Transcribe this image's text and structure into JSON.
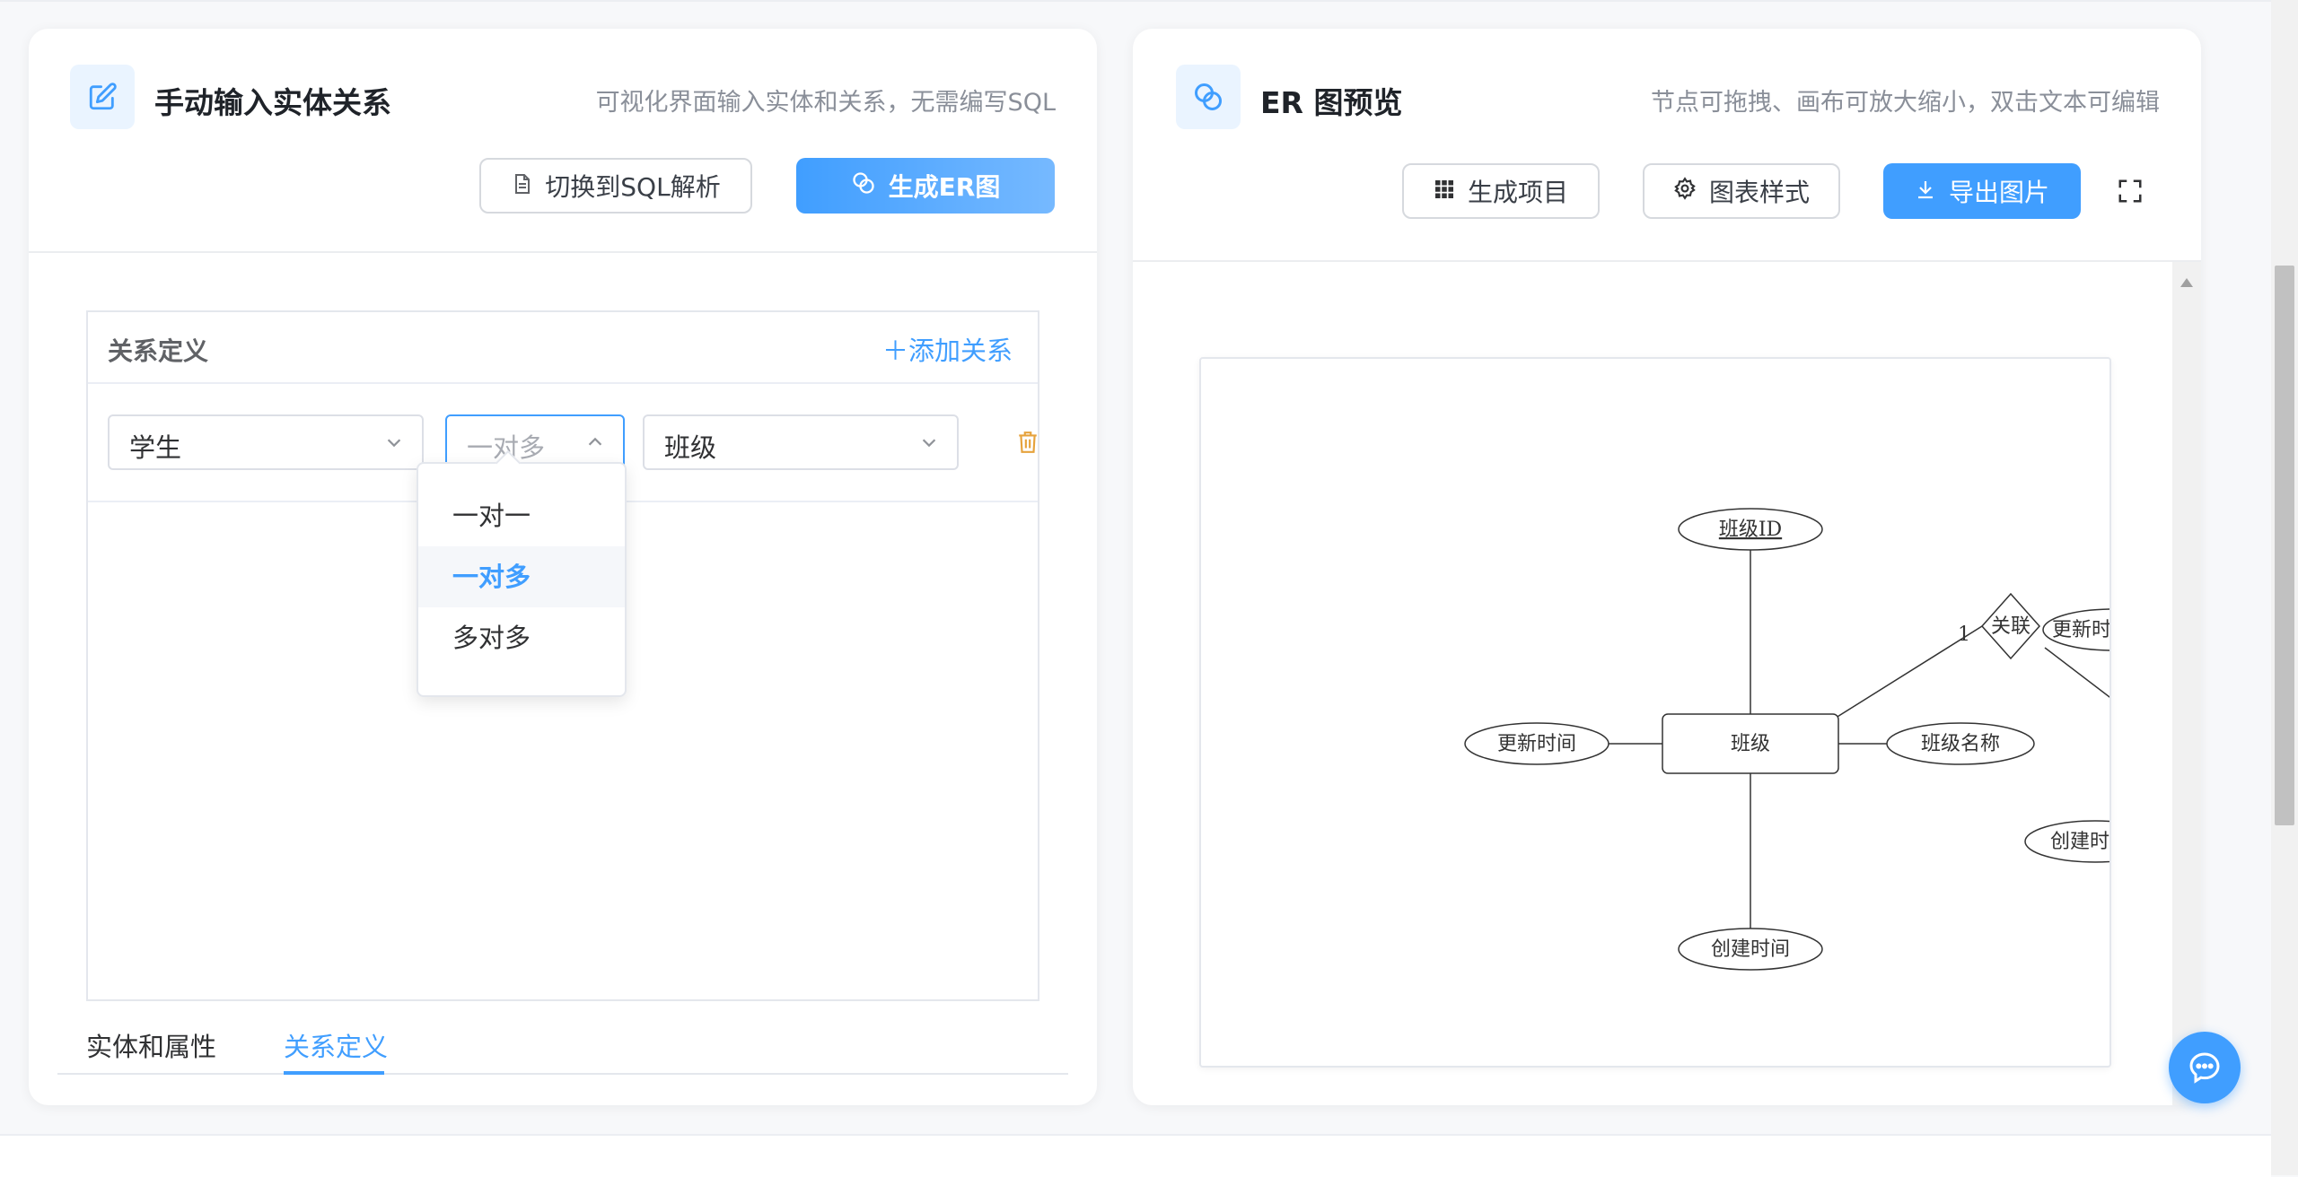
{
  "left_panel": {
    "title": "手动输入实体关系",
    "description": "可视化界面输入实体和关系，无需编写SQL",
    "switch_button": "切换到SQL解析",
    "generate_button": "生成ER图",
    "relation_section": {
      "title": "关系定义",
      "add_label": "＋添加关系",
      "row": {
        "from_entity": "学生",
        "relation_type": "一对多",
        "to_entity": "班级"
      },
      "dropdown_options": [
        "一对一",
        "一对多",
        "多对多"
      ],
      "dropdown_selected": "一对多"
    },
    "tabs": [
      {
        "label": "实体和属性",
        "active": false
      },
      {
        "label": "关系定义",
        "active": true
      }
    ]
  },
  "right_panel": {
    "title": "ER 图预览",
    "description": "节点可拖拽、画布可放大缩小，双击文本可编辑",
    "buttons": {
      "generate_project": "生成项目",
      "chart_style": "图表样式",
      "export_image": "导出图片"
    },
    "diagram": {
      "entity": "班级",
      "attributes": {
        "primary_key": "班级ID",
        "name": "班级名称",
        "updated": "更新时间",
        "created": "创建时间"
      },
      "relationship": "关联",
      "cardinality": "1",
      "partial_attributes": [
        "更新时",
        "创建时"
      ]
    }
  },
  "colors": {
    "accent": "#409eff",
    "danger_icon": "#e6a23c",
    "border": "#dcdfe6"
  },
  "icons": [
    "edit-icon",
    "document-icon",
    "link-icon",
    "chevron-down-icon",
    "chevron-up-icon",
    "trash-icon",
    "grid-icon",
    "gear-icon",
    "download-icon",
    "fullscreen-icon",
    "chat-icon"
  ]
}
